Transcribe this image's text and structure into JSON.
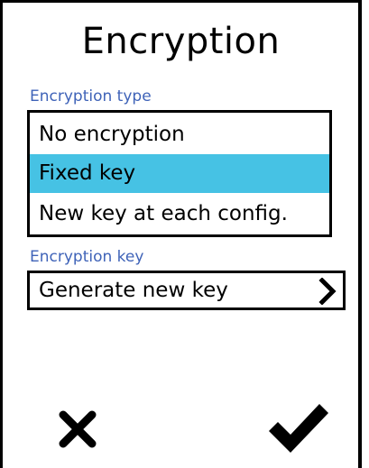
{
  "screen": {
    "title": "Encryption"
  },
  "encryption_type": {
    "label": "Encryption type",
    "options": [
      {
        "label": "No encryption",
        "selected": false
      },
      {
        "label": "Fixed key",
        "selected": true
      },
      {
        "label": "New key at each config.",
        "selected": false
      }
    ],
    "selected_color": "#46c2e4"
  },
  "encryption_key": {
    "label": "Encryption key",
    "button_label": "Generate new key",
    "button_icon": "chevron-right-icon"
  },
  "actions": {
    "cancel_icon": "cancel-x-icon",
    "confirm_icon": "confirm-checkmark-icon"
  },
  "colors": {
    "section_label": "#3f63b8",
    "text": "#000000",
    "background": "#ffffff"
  }
}
